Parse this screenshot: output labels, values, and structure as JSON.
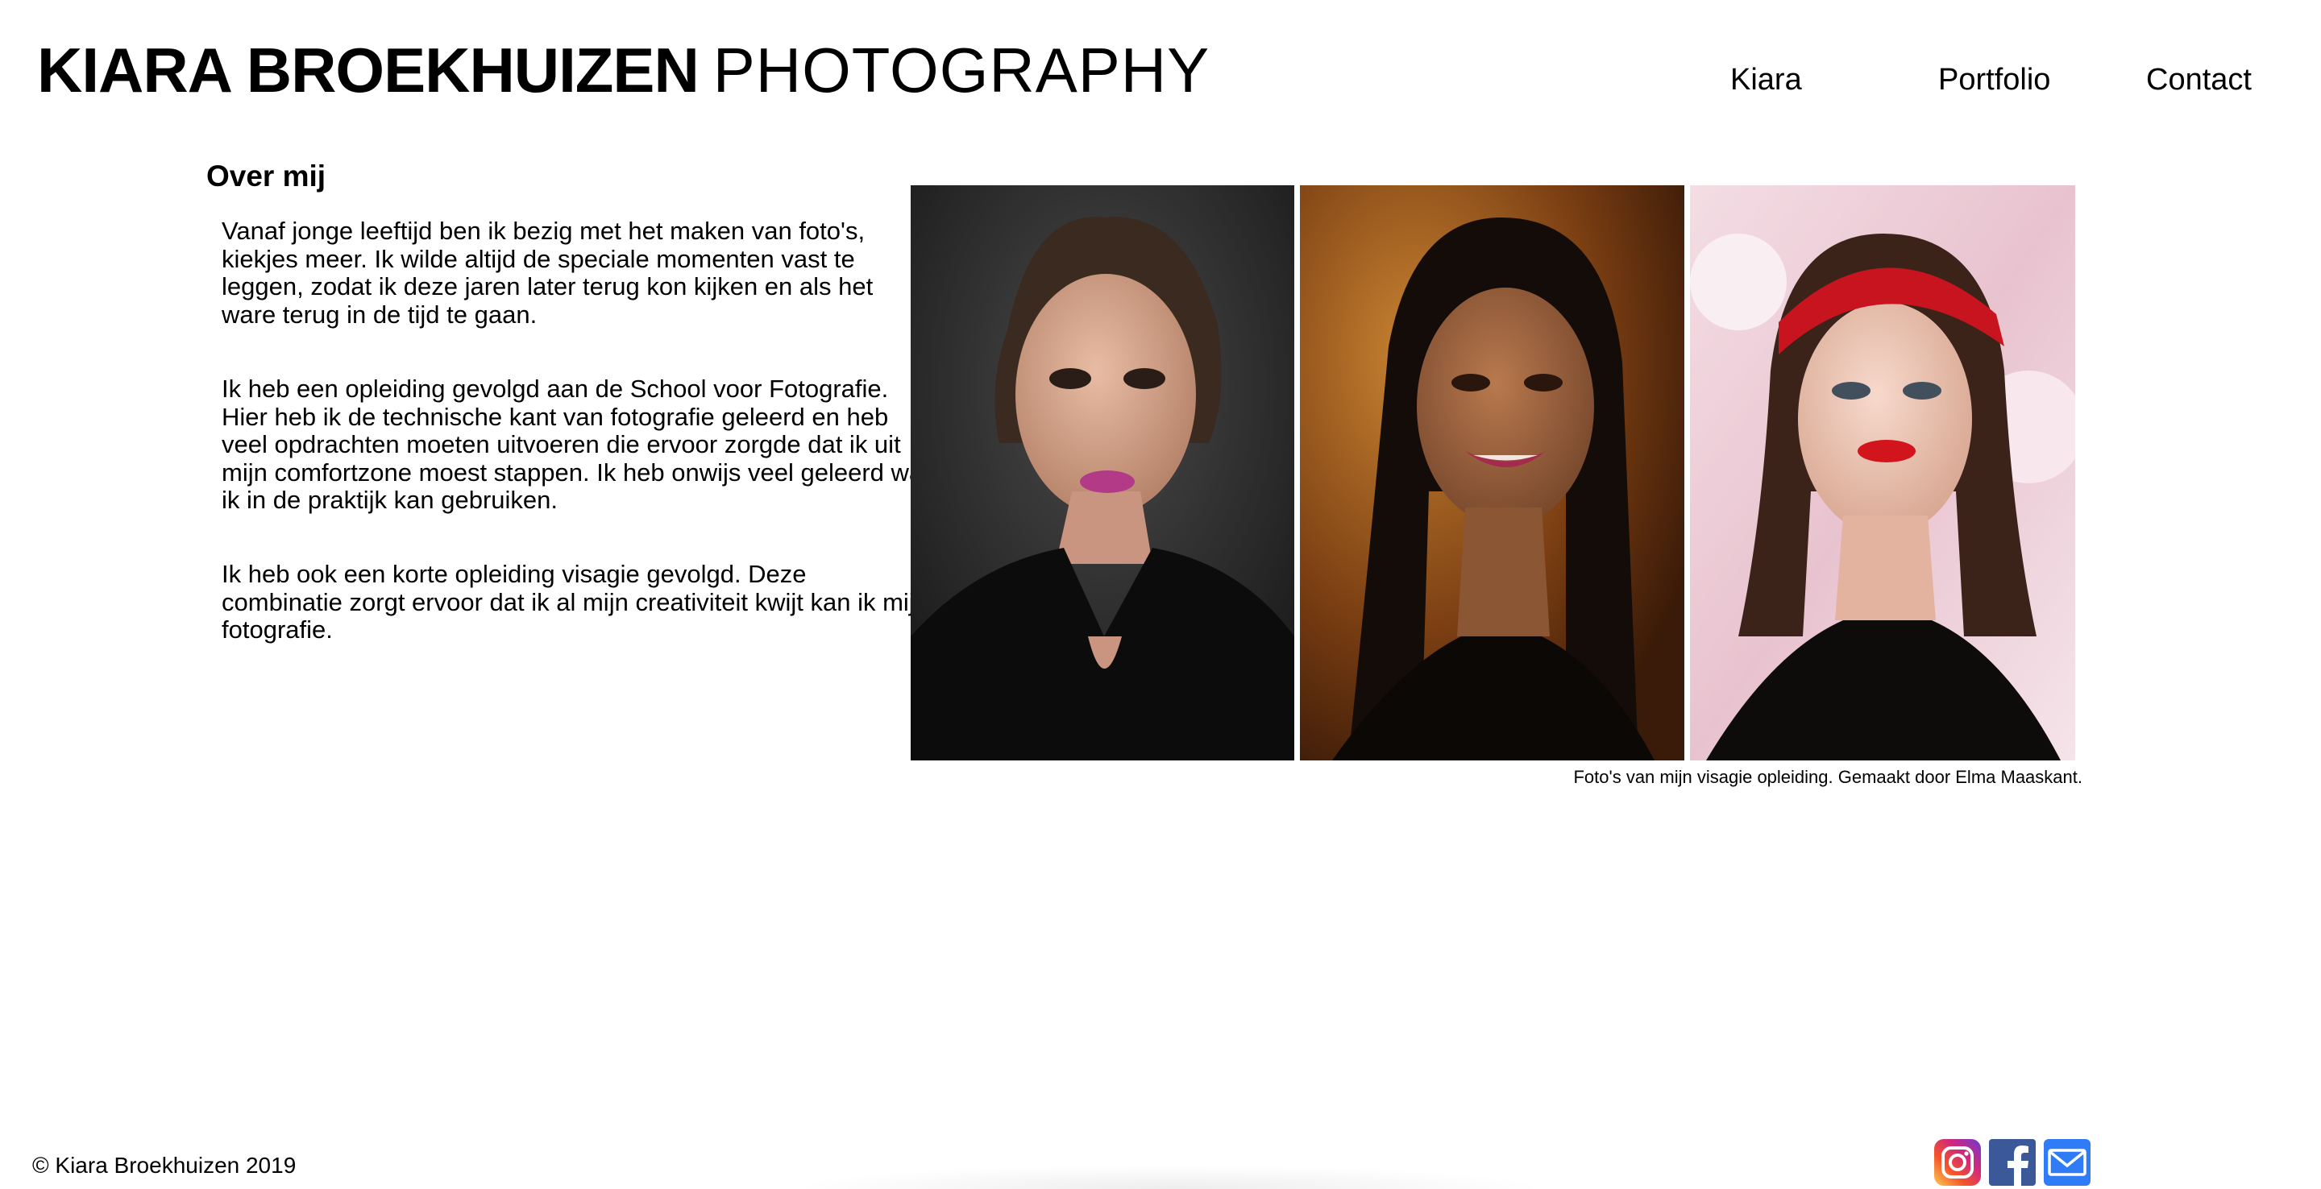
{
  "header": {
    "brand_bold": "KIARA BROEKHUIZEN",
    "brand_light": "PHOTOGRAPHY",
    "nav": [
      {
        "label": "Kiara"
      },
      {
        "label": "Portfolio"
      },
      {
        "label": "Contact"
      }
    ]
  },
  "about": {
    "title": "Over mij",
    "paragraphs": [
      "Vanaf jonge leeftijd ben ik bezig met het maken van foto's, kiekjes meer. Ik wilde altijd de speciale momenten vast te leggen, zodat ik deze jaren later terug kon kijken en als het ware terug in de tijd te gaan.",
      "Ik heb een opleiding gevolgd aan de School voor Fotografie. Hier heb ik de technische kant van fotografie geleerd en heb veel opdrachten moeten uitvoeren die ervoor zorgde dat ik uit mijn comfortzone moest stappen. Ik heb onwijs veel geleerd wat ik in de praktijk kan gebruiken.",
      "Ik heb ook een korte opleiding visagie gevolgd. Deze combinatie zorgt ervoor dat ik al mijn creativiteit kwijt kan ik mijn fotografie."
    ],
    "photos_caption": "Foto's van mijn visagie opleiding. Gemaakt door Elma Maaskant."
  },
  "footer": {
    "copyright": "© Kiara Broekhuizen 2019",
    "social": [
      {
        "icon": "instagram-icon",
        "color": "#c13584"
      },
      {
        "icon": "facebook-icon",
        "color": "#3b5998"
      },
      {
        "icon": "mail-icon",
        "color": "#2f7cf6"
      }
    ]
  },
  "colors": {
    "background": "#ffffff",
    "text": "#000000"
  }
}
